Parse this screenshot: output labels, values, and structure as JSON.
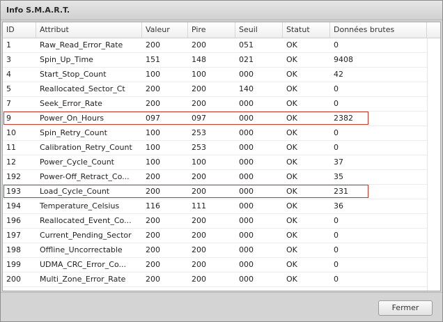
{
  "dialog": {
    "title": "Info S.M.A.R.T.",
    "close_label": "Fermer"
  },
  "table": {
    "columns": [
      "ID",
      "Attribut",
      "Valeur",
      "Pire",
      "Seuil",
      "Statut",
      "Données brutes"
    ],
    "rows": [
      {
        "id": "1",
        "attribute": "Raw_Read_Error_Rate",
        "value": "200",
        "worst": "200",
        "threshold": "051",
        "status": "OK",
        "raw": "0",
        "highlighted": false
      },
      {
        "id": "3",
        "attribute": "Spin_Up_Time",
        "value": "151",
        "worst": "148",
        "threshold": "021",
        "status": "OK",
        "raw": "9408",
        "highlighted": false
      },
      {
        "id": "4",
        "attribute": "Start_Stop_Count",
        "value": "100",
        "worst": "100",
        "threshold": "000",
        "status": "OK",
        "raw": "42",
        "highlighted": false
      },
      {
        "id": "5",
        "attribute": "Reallocated_Sector_Ct",
        "value": "200",
        "worst": "200",
        "threshold": "140",
        "status": "OK",
        "raw": "0",
        "highlighted": false
      },
      {
        "id": "7",
        "attribute": "Seek_Error_Rate",
        "value": "200",
        "worst": "200",
        "threshold": "000",
        "status": "OK",
        "raw": "0",
        "highlighted": false
      },
      {
        "id": "9",
        "attribute": "Power_On_Hours",
        "value": "097",
        "worst": "097",
        "threshold": "000",
        "status": "OK",
        "raw": "2382",
        "highlighted": true
      },
      {
        "id": "10",
        "attribute": "Spin_Retry_Count",
        "value": "100",
        "worst": "253",
        "threshold": "000",
        "status": "OK",
        "raw": "0",
        "highlighted": false
      },
      {
        "id": "11",
        "attribute": "Calibration_Retry_Count",
        "value": "100",
        "worst": "253",
        "threshold": "000",
        "status": "OK",
        "raw": "0",
        "highlighted": false
      },
      {
        "id": "12",
        "attribute": "Power_Cycle_Count",
        "value": "100",
        "worst": "100",
        "threshold": "000",
        "status": "OK",
        "raw": "37",
        "highlighted": false
      },
      {
        "id": "192",
        "attribute": "Power-Off_Retract_Co...",
        "value": "200",
        "worst": "200",
        "threshold": "000",
        "status": "OK",
        "raw": "35",
        "highlighted": false
      },
      {
        "id": "193",
        "attribute": "Load_Cycle_Count",
        "value": "200",
        "worst": "200",
        "threshold": "000",
        "status": "OK",
        "raw": "231",
        "highlighted": true
      },
      {
        "id": "194",
        "attribute": "Temperature_Celsius",
        "value": "116",
        "worst": "111",
        "threshold": "000",
        "status": "OK",
        "raw": "36",
        "highlighted": false
      },
      {
        "id": "196",
        "attribute": "Reallocated_Event_Co...",
        "value": "200",
        "worst": "200",
        "threshold": "000",
        "status": "OK",
        "raw": "0",
        "highlighted": false
      },
      {
        "id": "197",
        "attribute": "Current_Pending_Sector",
        "value": "200",
        "worst": "200",
        "threshold": "000",
        "status": "OK",
        "raw": "0",
        "highlighted": false
      },
      {
        "id": "198",
        "attribute": "Offline_Uncorrectable",
        "value": "200",
        "worst": "200",
        "threshold": "000",
        "status": "OK",
        "raw": "0",
        "highlighted": false
      },
      {
        "id": "199",
        "attribute": "UDMA_CRC_Error_Co...",
        "value": "200",
        "worst": "200",
        "threshold": "000",
        "status": "OK",
        "raw": "0",
        "highlighted": false
      },
      {
        "id": "200",
        "attribute": "Multi_Zone_Error_Rate",
        "value": "200",
        "worst": "200",
        "threshold": "000",
        "status": "OK",
        "raw": "0",
        "highlighted": false
      }
    ]
  },
  "colors": {
    "highlight_border": "#c0392b"
  }
}
